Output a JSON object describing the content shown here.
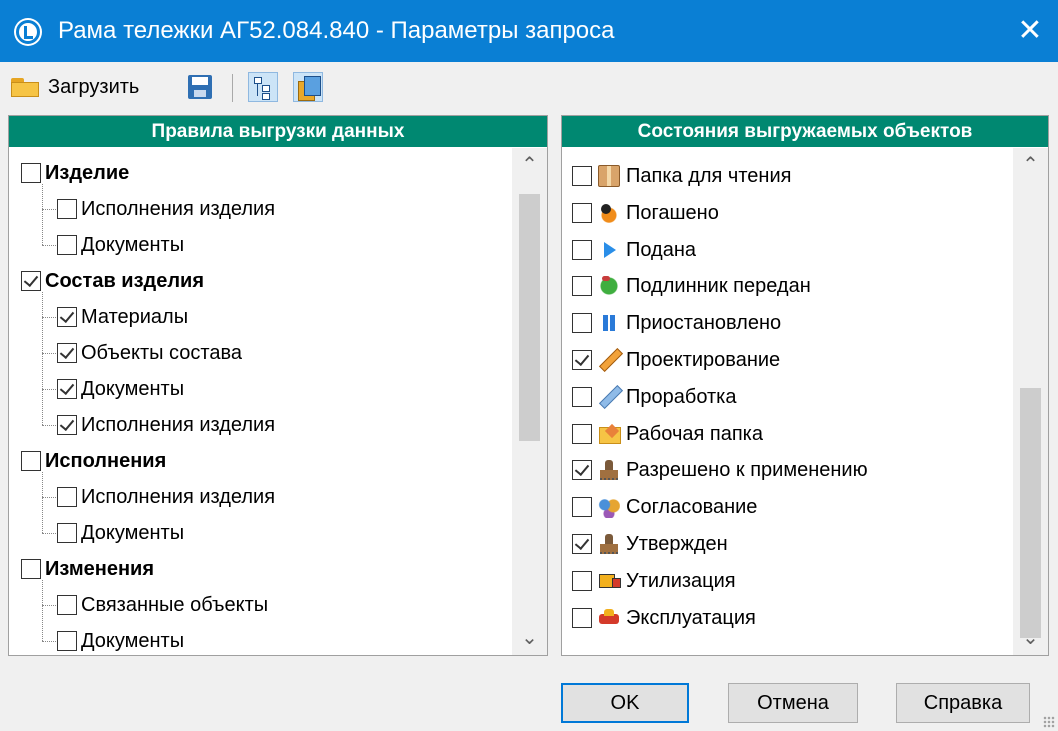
{
  "window": {
    "title": "Рама тележки АГ52.084.840 - Параметры запроса",
    "close_glyph": "✕",
    "app_icon": "app-logo-icon"
  },
  "toolbar": {
    "load_label": "Загрузить",
    "icons": [
      "folder-open-icon",
      "save-icon",
      "tree-view-icon",
      "list-view-icon"
    ]
  },
  "left_panel": {
    "header": "Правила выгрузки данных",
    "nodes": [
      {
        "label": "Изделие",
        "checked": false,
        "level": 0
      },
      {
        "label": "Исполнения изделия",
        "checked": false,
        "level": 1
      },
      {
        "label": "Документы",
        "checked": false,
        "level": 1
      },
      {
        "label": "Состав изделия",
        "checked": true,
        "level": 0
      },
      {
        "label": "Материалы",
        "checked": true,
        "level": 1
      },
      {
        "label": "Объекты состава",
        "checked": true,
        "level": 1
      },
      {
        "label": "Документы",
        "checked": true,
        "level": 1
      },
      {
        "label": "Исполнения изделия",
        "checked": true,
        "level": 1
      },
      {
        "label": "Исполнения",
        "checked": false,
        "level": 0
      },
      {
        "label": "Исполнения изделия",
        "checked": false,
        "level": 1
      },
      {
        "label": "Документы",
        "checked": false,
        "level": 1
      },
      {
        "label": "Изменения",
        "checked": false,
        "level": 0
      },
      {
        "label": "Связанные объекты",
        "checked": false,
        "level": 1
      },
      {
        "label": "Документы",
        "checked": false,
        "level": 1
      }
    ]
  },
  "right_panel": {
    "header": "Состояния выгружаемых объектов",
    "items": [
      {
        "label": "Папка для чтения",
        "checked": false,
        "icon": "read-folder-icon"
      },
      {
        "label": "Погашено",
        "checked": false,
        "icon": "cancelled-icon"
      },
      {
        "label": "Подана",
        "checked": false,
        "icon": "play-icon"
      },
      {
        "label": "Подлинник передан",
        "checked": false,
        "icon": "original-transferred-icon"
      },
      {
        "label": "Приостановлено",
        "checked": false,
        "icon": "pause-icon"
      },
      {
        "label": "Проектирование",
        "checked": true,
        "icon": "pencil-icon"
      },
      {
        "label": "Проработка",
        "checked": false,
        "icon": "pencil-draft-icon"
      },
      {
        "label": "Рабочая папка",
        "checked": false,
        "icon": "work-folder-icon"
      },
      {
        "label": "Разрешено к применению",
        "checked": true,
        "icon": "stamp-icon"
      },
      {
        "label": "Согласование",
        "checked": false,
        "icon": "approval-people-icon"
      },
      {
        "label": "Утвержден",
        "checked": true,
        "icon": "stamp-approved-icon"
      },
      {
        "label": "Утилизация",
        "checked": false,
        "icon": "disposal-truck-icon"
      },
      {
        "label": "Эксплуатация",
        "checked": false,
        "icon": "operation-car-icon"
      }
    ]
  },
  "scrollbar": {
    "up_glyph": "⌃",
    "down_glyph": "⌄"
  },
  "buttons": {
    "ok": "OK",
    "cancel": "Отмена",
    "help": "Справка"
  }
}
